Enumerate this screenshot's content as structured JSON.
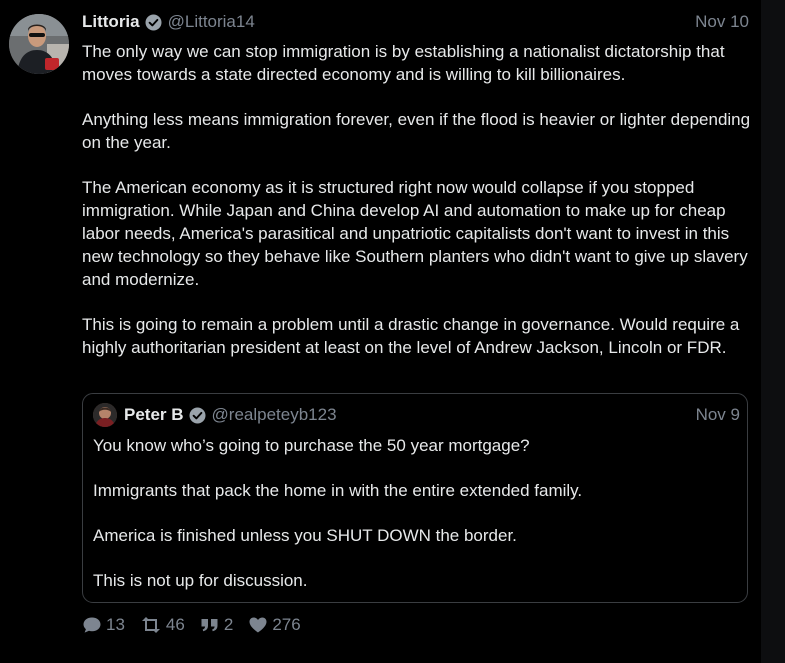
{
  "tweet": {
    "author_name": "Littoria",
    "author_handle": "@Littoria14",
    "date": "Nov 10",
    "paragraphs": [
      "The only way we can stop immigration is by establishing a nationalist dictatorship that moves towards a state directed economy and is willing to kill billionaires.",
      "Anything less means immigration forever, even if the flood is heavier or lighter depending on the year.",
      "The American economy as it is structured right now would collapse if you stopped immigration. While Japan and China develop AI and automation to make up for cheap labor needs, America's parasitical and unpatriotic capitalists don't want to invest in this new technology so they behave like Southern planters who didn't want to give up slavery and modernize.",
      "This is going to remain a problem until a drastic change in governance. Would require a highly authoritarian president at least on the level of Andrew Jackson, Lincoln or FDR."
    ]
  },
  "quote": {
    "author_name": "Peter B",
    "author_handle": "@realpeteyb123",
    "date": "Nov 9",
    "paragraphs": [
      "You know who’s going to purchase the 50 year mortgage?",
      "Immigrants that pack the home in with the entire extended family.",
      "America is finished unless you SHUT DOWN the border.",
      "This is not up for discussion."
    ]
  },
  "actions": {
    "replies": "13",
    "retweets": "46",
    "quotes": "2",
    "likes": "276"
  },
  "colors": {
    "background": "#000000",
    "text": "#e7e9ea",
    "muted": "#7d8590",
    "border": "#3a3d41",
    "verified": "#9aa3ab"
  },
  "icons": [
    "verified-badge-icon",
    "reply-icon",
    "retweet-icon",
    "quote-icon",
    "like-icon"
  ]
}
